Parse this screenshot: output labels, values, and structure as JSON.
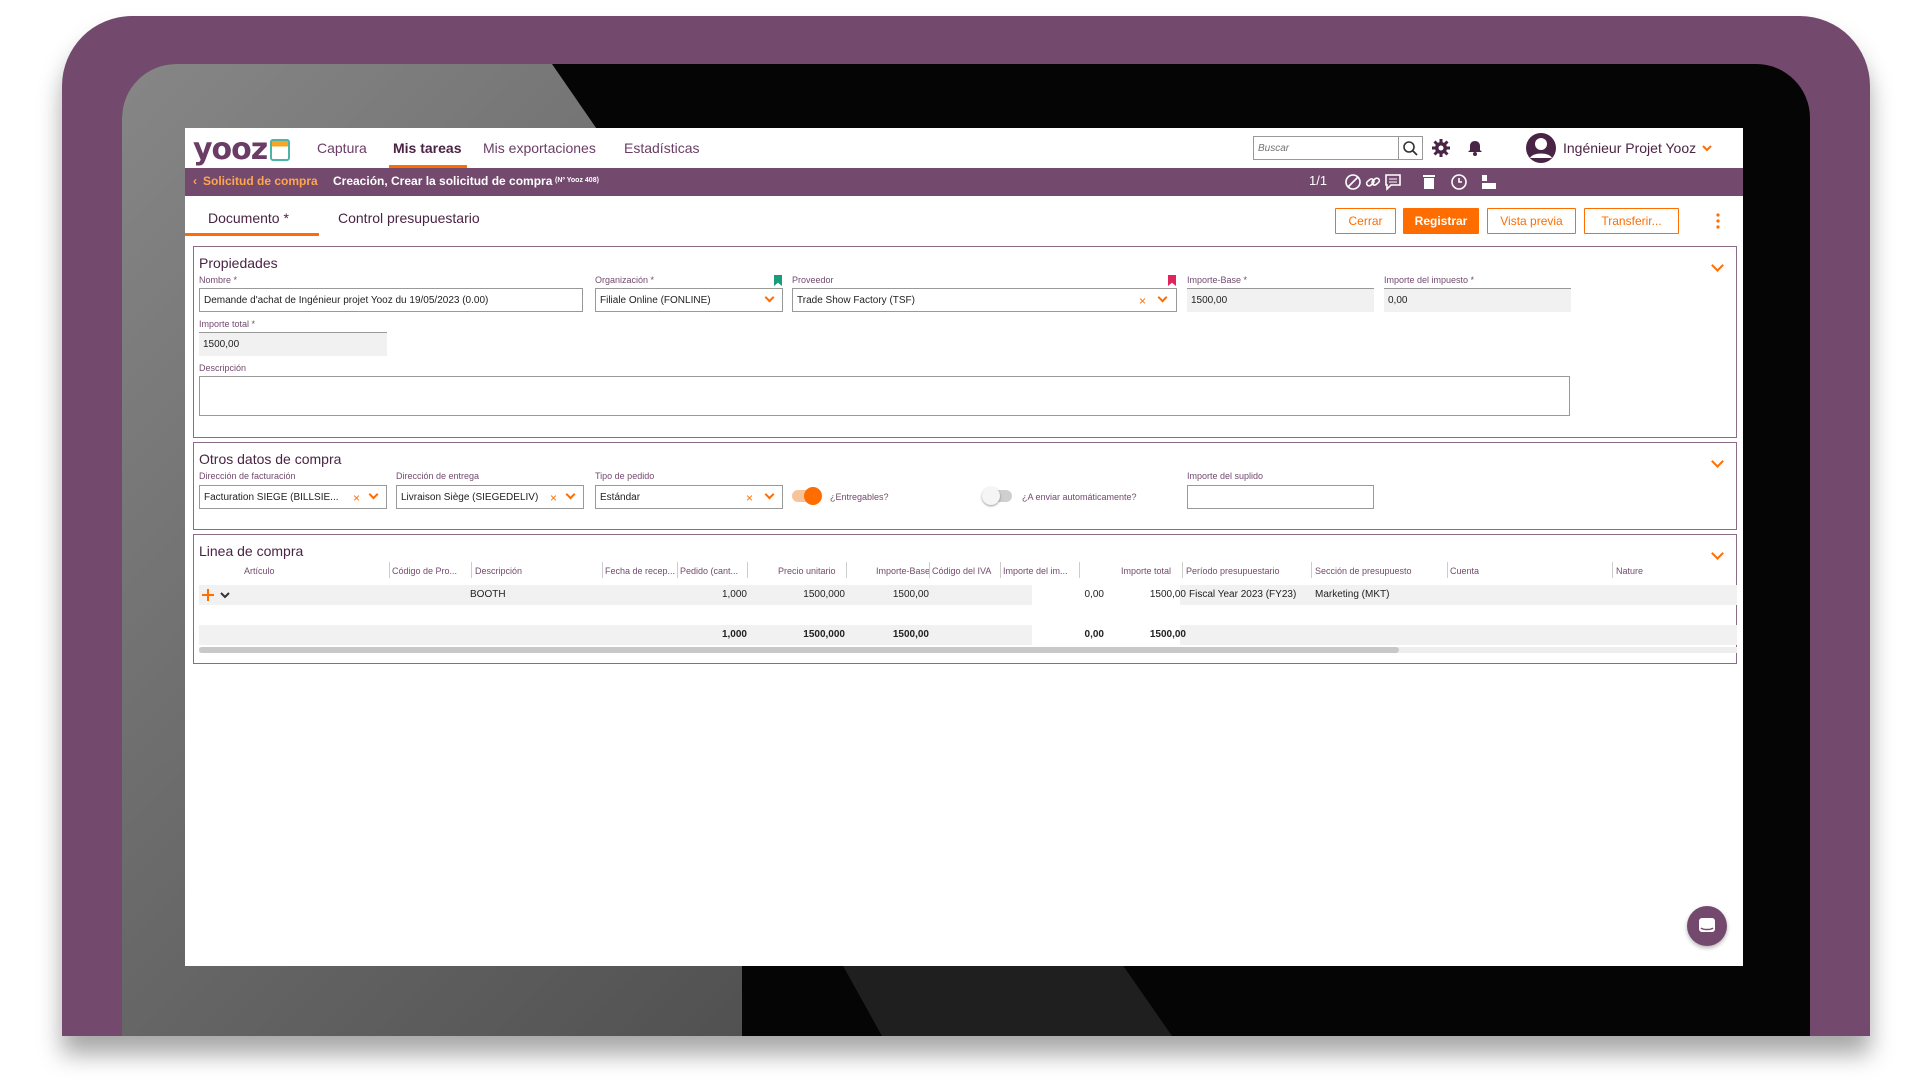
{
  "nav": {
    "logo": "yooz",
    "items": [
      "Captura",
      "Mis tareas",
      "Mis exportaciones",
      "Estadísticas"
    ],
    "search_placeholder": "Buscar",
    "user_name": "Ingénieur Projet Yooz"
  },
  "breadcrumb": {
    "back_label": "Solicitud de compra",
    "title": "Creación, Crear la solicitud de compra",
    "doc_id": "(Nº Yooz 408)",
    "page_indicator": "1/1"
  },
  "tabs": [
    "Documento *",
    "Control presupuestario"
  ],
  "actions": {
    "close": "Cerrar",
    "register": "Registrar",
    "preview": "Vista previa",
    "transfer": "Transferir..."
  },
  "properties": {
    "title": "Propiedades",
    "name_label": "Nombre *",
    "name_value": "Demande d'achat de Ingénieur projet Yooz du 19/05/2023 (0.00)",
    "org_label": "Organización *",
    "org_value": "Filiale Online (FONLINE)",
    "supplier_label": "Proveedor",
    "supplier_value": "Trade Show Factory (TSF)",
    "base_label": "Importe-Base *",
    "base_value": "1500,00",
    "tax_label": "Importe del impuesto *",
    "tax_value": "0,00",
    "total_label": "Importe total *",
    "total_value": "1500,00",
    "desc_label": "Descripción",
    "desc_value": ""
  },
  "other": {
    "title": "Otros datos de compra",
    "billing_label": "Dirección de facturación",
    "billing_value": "Facturation SIEGE (BILLSIE...",
    "delivery_label": "Dirección de entrega",
    "delivery_value": "Livraison Siège (SIEGEDELIV)",
    "order_type_label": "Tipo de pedido",
    "order_type_value": "Estándar",
    "deliverables_label": "¿Entregables?",
    "deliverables_on": true,
    "auto_send_label": "¿A enviar automáticamente?",
    "auto_send_on": false,
    "supplement_label": "Importe del suplido",
    "supplement_value": ""
  },
  "lines": {
    "title": "Linea de compra",
    "headers": [
      "Artículo",
      "Código de Pro...",
      "Descripción",
      "Fecha de recep...",
      "Pedido (cant...",
      "Precio unitario",
      "Importe-Base",
      "Código del IVA",
      "Importe del im...",
      "Importe total",
      "Período presupuestario",
      "Sección de presupuesto",
      "Cuenta",
      "Nature"
    ],
    "row": {
      "description": "BOOTH",
      "quantity": "1,000",
      "unit_price": "1500,000",
      "base": "1500,00",
      "tax": "0,00",
      "total": "1500,00",
      "period": "Fiscal Year 2023 (FY23)",
      "section": "Marketing (MKT)"
    },
    "totals": {
      "quantity": "1,000",
      "unit_price": "1500,000",
      "base": "1500,00",
      "tax": "0,00",
      "total": "1500,00"
    }
  },
  "colors": {
    "frame": "#734a6e",
    "accent": "#ff6d00",
    "bookmark_green": "#1a9c7c",
    "bookmark_red": "#e0245e"
  },
  "icons": [
    "search-icon",
    "gear-icon",
    "bell-icon",
    "user-avatar-icon",
    "chevron-down-icon",
    "chevron-left-icon",
    "cancel-icon",
    "link-icon",
    "comment-icon",
    "trash-icon",
    "clock-icon",
    "layout-icon",
    "kebab-menu-icon",
    "plus-icon",
    "chat-icon"
  ]
}
